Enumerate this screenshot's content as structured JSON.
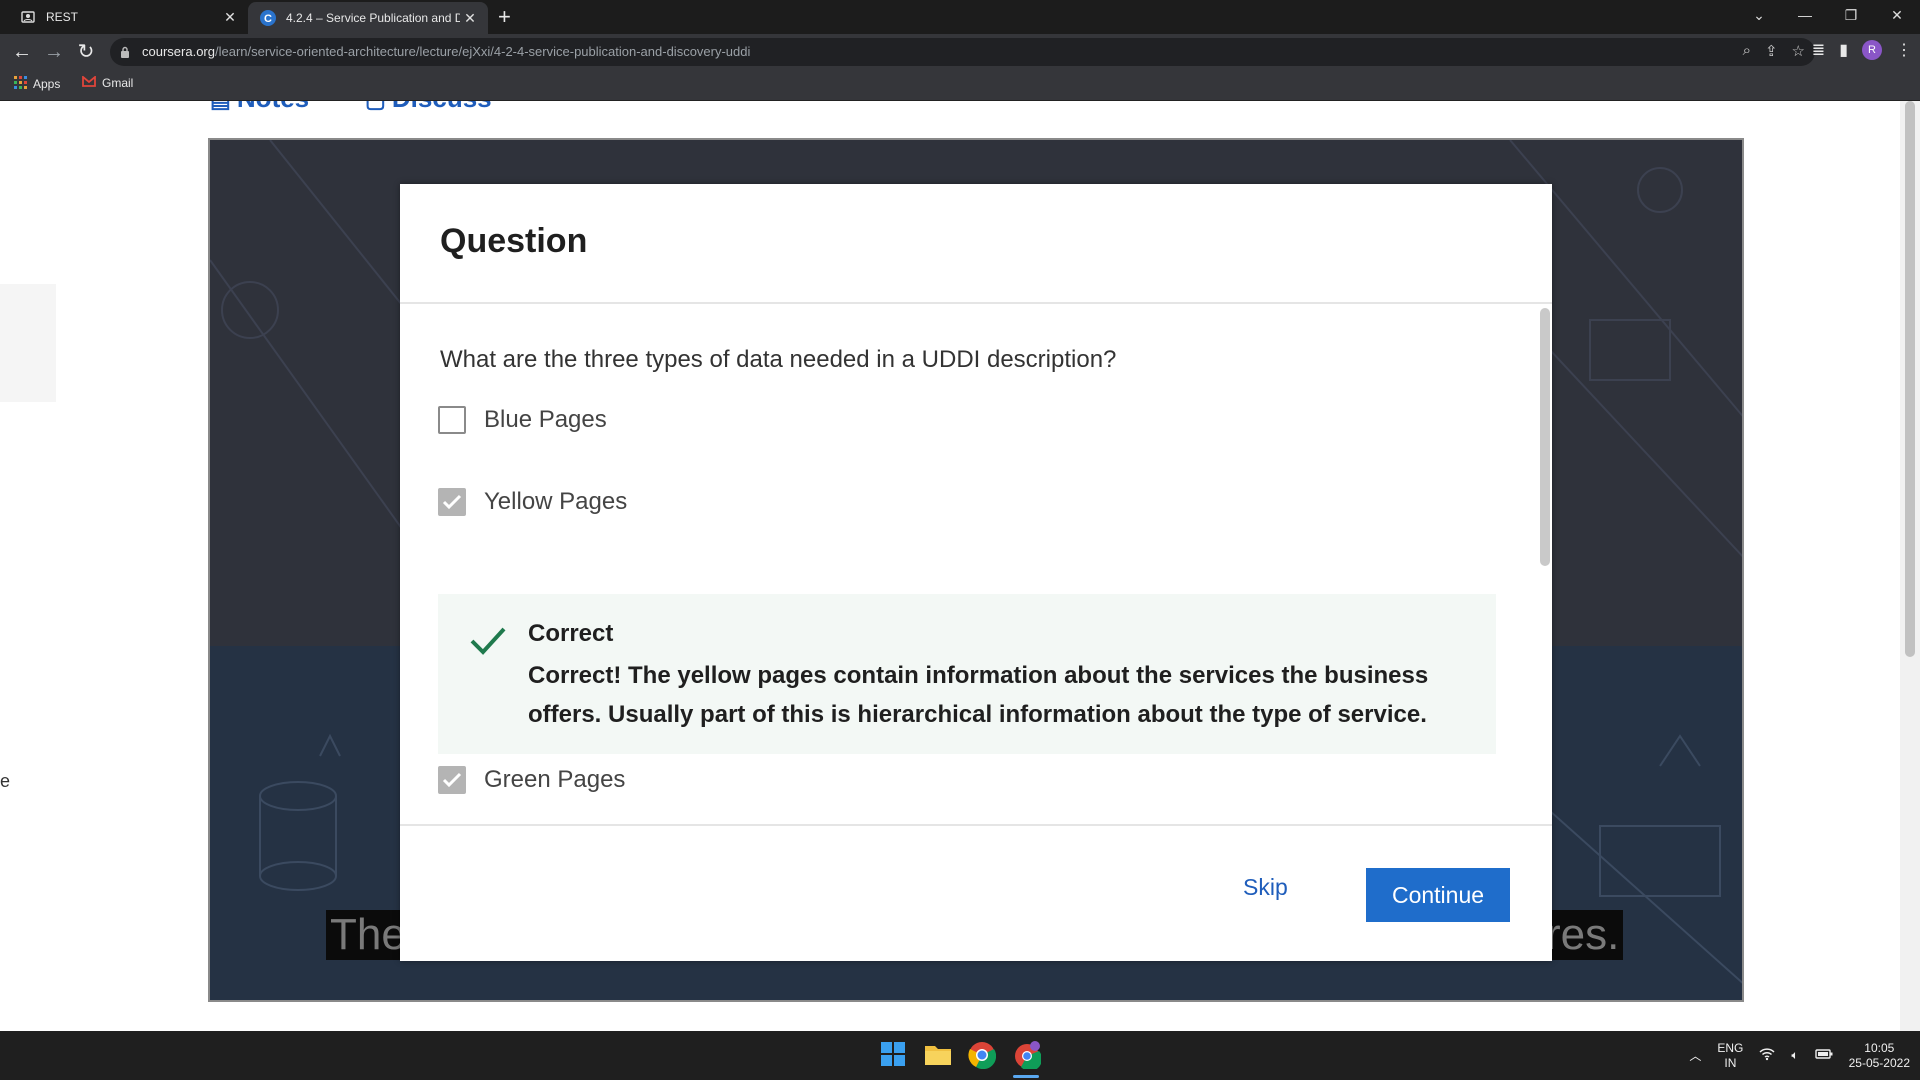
{
  "browser": {
    "tabs": [
      {
        "title": "REST"
      },
      {
        "title": "4.2.4 – Service Publication and D"
      }
    ],
    "new_tab": "+",
    "url_domain": "coursera.org",
    "url_path": "/learn/service-oriented-architecture/lecture/ejXxi/4-2-4-service-publication-and-discovery-uddi",
    "profile_initial": "R",
    "bookmarks": [
      {
        "label": "Apps"
      },
      {
        "label": "Gmail"
      }
    ]
  },
  "page": {
    "links": {
      "notes": "Notes",
      "discuss": "Discuss"
    },
    "edge_letter": "e",
    "caption_left": "The",
    "caption_right": "res."
  },
  "quiz": {
    "title": "Question",
    "prompt": "What are the three types of data needed in a UDDI description?",
    "options": [
      {
        "label": "Blue Pages",
        "checked": false
      },
      {
        "label": "Yellow Pages",
        "checked": true
      },
      {
        "label": "Green Pages",
        "checked": true
      }
    ],
    "feedback": {
      "title": "Correct",
      "text": "Correct! The yellow pages contain information about the services the business offers. Usually part of this is hierarchical information about the type of service."
    },
    "skip_label": "Skip",
    "continue_label": "Continue"
  },
  "taskbar": {
    "language_line1": "ENG",
    "language_line2": "IN",
    "time": "10:05",
    "date": "25-05-2022"
  },
  "colors": {
    "accent": "#1f6dcb",
    "link": "#1f5dbb",
    "correct": "#1f7a4d"
  }
}
